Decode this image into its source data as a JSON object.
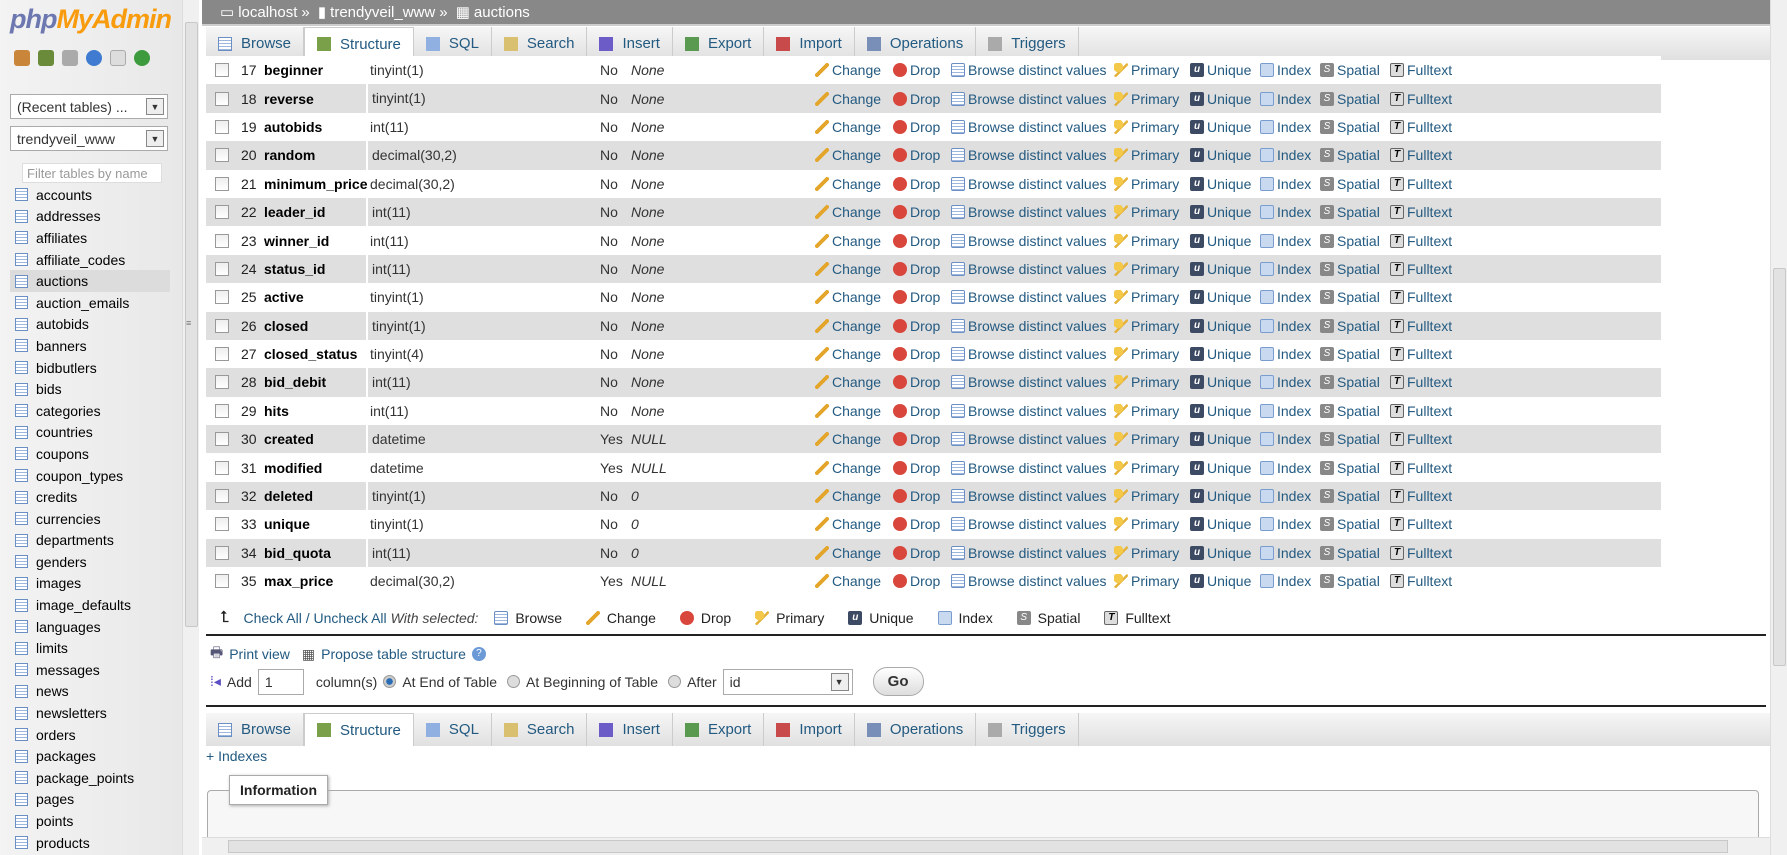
{
  "app": {
    "logo_php": "php",
    "logo_my": "MyAdmin"
  },
  "sidebar": {
    "recent_tables": "(Recent tables) ...",
    "database": "trendyveil_www",
    "filter_placeholder": "Filter tables by name",
    "active_table": "auctions",
    "tables": [
      "accounts",
      "addresses",
      "affiliates",
      "affiliate_codes",
      "auctions",
      "auction_emails",
      "autobids",
      "banners",
      "bidbutlers",
      "bids",
      "categories",
      "countries",
      "coupons",
      "coupon_types",
      "credits",
      "currencies",
      "departments",
      "genders",
      "images",
      "image_defaults",
      "languages",
      "limits",
      "messages",
      "news",
      "newsletters",
      "orders",
      "packages",
      "package_points",
      "pages",
      "points",
      "products"
    ]
  },
  "breadcrumb": {
    "server": "localhost",
    "sep": "»",
    "database": "trendyveil_www",
    "table": "auctions"
  },
  "tabs": [
    {
      "label": "Browse",
      "icon": "browse-icon"
    },
    {
      "label": "Structure",
      "icon": "structure-icon",
      "active": true
    },
    {
      "label": "SQL",
      "icon": "sql-icon"
    },
    {
      "label": "Search",
      "icon": "search-icon"
    },
    {
      "label": "Insert",
      "icon": "insert-icon"
    },
    {
      "label": "Export",
      "icon": "export-icon"
    },
    {
      "label": "Import",
      "icon": "import-icon"
    },
    {
      "label": "Operations",
      "icon": "wrench-icon"
    },
    {
      "label": "Triggers",
      "icon": "triggers-icon"
    }
  ],
  "actions": {
    "change": "Change",
    "drop": "Drop",
    "browse_distinct": "Browse distinct values",
    "primary": "Primary",
    "unique": "Unique",
    "index": "Index",
    "spatial": "Spatial",
    "fulltext": "Fulltext"
  },
  "columns": [
    {
      "n": "17",
      "name": "beginner",
      "type": "tinyint(1)",
      "null": "No",
      "default": "None"
    },
    {
      "n": "18",
      "name": "reverse",
      "type": "tinyint(1)",
      "null": "No",
      "default": "None"
    },
    {
      "n": "19",
      "name": "autobids",
      "type": "int(11)",
      "null": "No",
      "default": "None"
    },
    {
      "n": "20",
      "name": "random",
      "type": "decimal(30,2)",
      "null": "No",
      "default": "None"
    },
    {
      "n": "21",
      "name": "minimum_price",
      "type": "decimal(30,2)",
      "null": "No",
      "default": "None"
    },
    {
      "n": "22",
      "name": "leader_id",
      "type": "int(11)",
      "null": "No",
      "default": "None"
    },
    {
      "n": "23",
      "name": "winner_id",
      "type": "int(11)",
      "null": "No",
      "default": "None"
    },
    {
      "n": "24",
      "name": "status_id",
      "type": "int(11)",
      "null": "No",
      "default": "None"
    },
    {
      "n": "25",
      "name": "active",
      "type": "tinyint(1)",
      "null": "No",
      "default": "None"
    },
    {
      "n": "26",
      "name": "closed",
      "type": "tinyint(1)",
      "null": "No",
      "default": "None"
    },
    {
      "n": "27",
      "name": "closed_status",
      "type": "tinyint(4)",
      "null": "No",
      "default": "None"
    },
    {
      "n": "28",
      "name": "bid_debit",
      "type": "int(11)",
      "null": "No",
      "default": "None"
    },
    {
      "n": "29",
      "name": "hits",
      "type": "int(11)",
      "null": "No",
      "default": "None"
    },
    {
      "n": "30",
      "name": "created",
      "type": "datetime",
      "null": "Yes",
      "default": "NULL"
    },
    {
      "n": "31",
      "name": "modified",
      "type": "datetime",
      "null": "Yes",
      "default": "NULL"
    },
    {
      "n": "32",
      "name": "deleted",
      "type": "tinyint(1)",
      "null": "No",
      "default": "0"
    },
    {
      "n": "33",
      "name": "unique",
      "type": "tinyint(1)",
      "null": "No",
      "default": "0"
    },
    {
      "n": "34",
      "name": "bid_quota",
      "type": "int(11)",
      "null": "No",
      "default": "0"
    },
    {
      "n": "35",
      "name": "max_price",
      "type": "decimal(30,2)",
      "null": "Yes",
      "default": "NULL"
    }
  ],
  "bulk": {
    "check_all": "Check All / Uncheck All",
    "with_selected": "With selected:",
    "browse": "Browse",
    "change": "Change",
    "drop": "Drop",
    "primary": "Primary",
    "unique": "Unique",
    "index": "Index",
    "spatial": "Spatial",
    "fulltext": "Fulltext"
  },
  "tools": {
    "printview": "Print view",
    "propose": "Propose table structure"
  },
  "add": {
    "label": "Add",
    "count": "1",
    "columns": "column(s)",
    "at_end": "At End of Table",
    "at_beginning": "At Beginning of Table",
    "after": "After",
    "after_field": "id",
    "go": "Go"
  },
  "indexes_link": "+ Indexes",
  "information": "Information"
}
